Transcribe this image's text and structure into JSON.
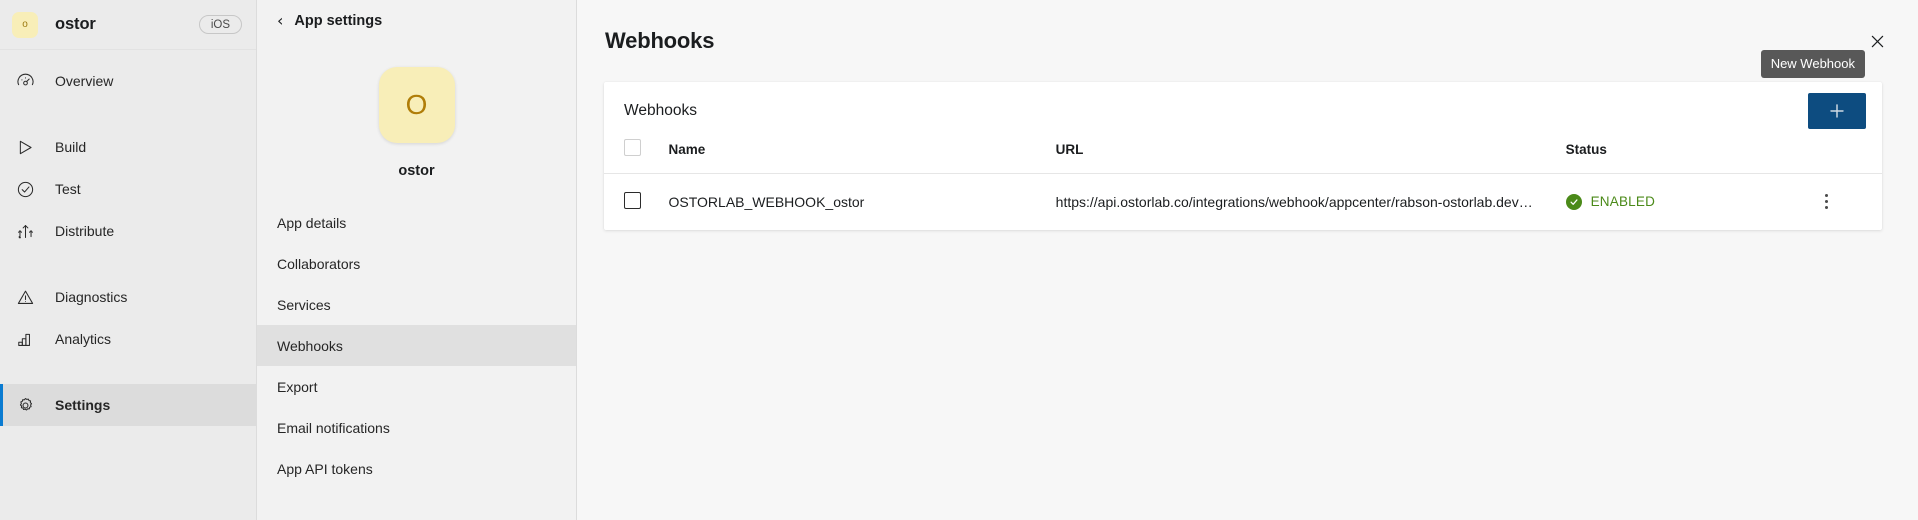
{
  "leftnav": {
    "app": {
      "icon_letter": "o",
      "name": "ostor",
      "platform": "iOS"
    },
    "items": [
      {
        "label": "Overview",
        "icon": "gauge-icon",
        "active": false
      },
      {
        "label": "Build",
        "icon": "play-icon",
        "active": false
      },
      {
        "label": "Test",
        "icon": "check-circle-icon",
        "active": false
      },
      {
        "label": "Distribute",
        "icon": "distribute-icon",
        "active": false
      },
      {
        "label": "Diagnostics",
        "icon": "warning-triangle-icon",
        "active": false
      },
      {
        "label": "Analytics",
        "icon": "bar-chart-icon",
        "active": false
      },
      {
        "label": "Settings",
        "icon": "gear-icon",
        "active": true
      }
    ]
  },
  "settings_panel": {
    "back_icon": "chevron-left-icon",
    "title": "App settings",
    "app_icon_letter": "O",
    "app_name": "ostor",
    "menu": [
      {
        "label": "App details",
        "selected": false
      },
      {
        "label": "Collaborators",
        "selected": false
      },
      {
        "label": "Services",
        "selected": false
      },
      {
        "label": "Webhooks",
        "selected": true
      },
      {
        "label": "Export",
        "selected": false
      },
      {
        "label": "Email notifications",
        "selected": false
      },
      {
        "label": "App API tokens",
        "selected": false
      }
    ]
  },
  "main": {
    "title": "Webhooks",
    "close_icon": "close-icon",
    "card": {
      "title": "Webhooks",
      "tooltip": "New Webhook",
      "add_icon": "plus-icon",
      "columns": [
        "",
        "Name",
        "URL",
        "Status",
        ""
      ],
      "rows": [
        {
          "selected": false,
          "name": "OSTORLAB_WEBHOOK_ostor",
          "url": "https://api.ostorlab.co/integrations/webhook/appcenter/rabson-ostorlab.dev/…",
          "status": "ENABLED",
          "status_icon": "check-circle-filled-icon",
          "menu_icon": "kebab-menu-icon"
        }
      ]
    }
  },
  "colors": {
    "accent_blue": "#0d4c80",
    "active_indicator": "#0a7bd1",
    "status_green": "#4b8a19",
    "app_icon_bg": "#f8eeb8",
    "tooltip_bg": "#585858"
  }
}
